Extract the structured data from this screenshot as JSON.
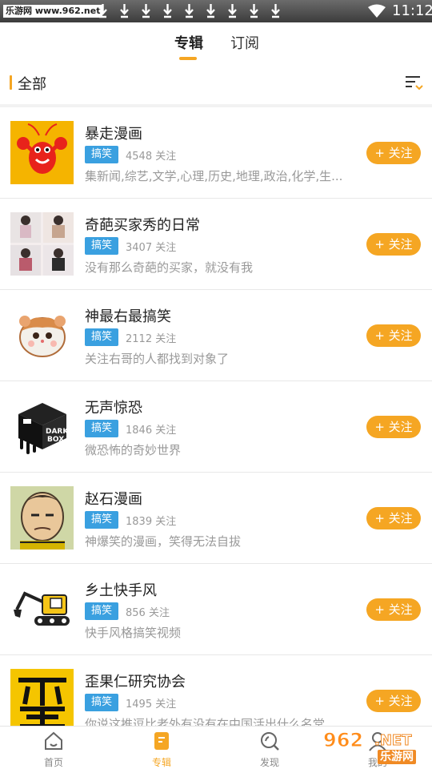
{
  "status_bar": {
    "site": "乐游网 www.962.net",
    "time": "11:12"
  },
  "tabs": [
    {
      "label": "专辑"
    },
    {
      "label": "订阅"
    }
  ],
  "section": {
    "title": "全部"
  },
  "items": [
    {
      "title": "暴走漫画",
      "tag": "搞笑",
      "count": "4548 关注",
      "desc": "集新闻,综艺,文学,心理,历史,地理,政治,化学,生...",
      "follow": "+ 关注",
      "thumb": "red-crayfish-logo"
    },
    {
      "title": "奇葩买家秀的日常",
      "tag": "搞笑",
      "count": "3407 关注",
      "desc": "没有那么奇葩的买家，就没有我",
      "follow": "+ 关注",
      "thumb": "buyer-show-collage"
    },
    {
      "title": "神最右最搞笑",
      "tag": "搞笑",
      "count": "2112 关注",
      "desc": "关注右哥的人都找到对象了",
      "follow": "+ 关注",
      "thumb": "hamster-cartoon"
    },
    {
      "title": "无声惊恐",
      "tag": "搞笑",
      "count": "1846 关注",
      "desc": "微恐怖的奇妙世界",
      "follow": "+ 关注",
      "thumb": "dark-box-logo"
    },
    {
      "title": "赵石漫画",
      "tag": "搞笑",
      "count": "1839 关注",
      "desc": "神爆笑的漫画，笑得无法自拔",
      "follow": "+ 关注",
      "thumb": "cartoon-face"
    },
    {
      "title": "乡土快手风",
      "tag": "搞笑",
      "count": "856 关注",
      "desc": "快手风格搞笑视频",
      "follow": "+ 关注",
      "thumb": "excavator-cartoon"
    },
    {
      "title": "歪果仁研究协会",
      "tag": "搞笑",
      "count": "1495 关注",
      "desc": "你说这推逗比老外有没有在中国活出什么名堂",
      "follow": "+ 关注",
      "thumb": "wai-character-logo"
    }
  ],
  "bottom_nav": [
    {
      "label": "首页",
      "icon": "home-icon"
    },
    {
      "label": "专辑",
      "icon": "album-icon"
    },
    {
      "label": "发现",
      "icon": "discover-icon"
    },
    {
      "label": "我的",
      "icon": "profile-icon"
    }
  ],
  "watermark": {
    "number": "962",
    "suffix": ".NET",
    "cn": "乐游网"
  },
  "colors": {
    "accent": "#f5a623",
    "tag": "#3aa0e0"
  }
}
